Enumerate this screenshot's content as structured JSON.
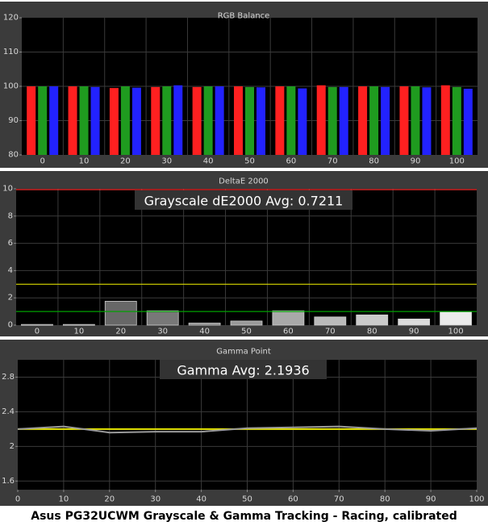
{
  "caption": "Asus PG32UCWM Grayscale & Gamma Tracking - Racing, calibrated",
  "colors": {
    "panel_bg": "#3b3b3b",
    "plot_bg": "#000000",
    "grid": "#3a3a3a",
    "text": "#d8d8d8",
    "red": "#ff2020",
    "green": "#1f9b1f",
    "blue": "#2222ff",
    "limit_red": "#ff3030",
    "limit_yellow": "#d8d800",
    "limit_green": "#00a000",
    "gamma_target": "#e6e600",
    "gamma_measured": "#9a9a9a"
  },
  "chart_data": [
    {
      "type": "bar",
      "title": "RGB Balance",
      "categories": [
        "0",
        "10",
        "20",
        "30",
        "40",
        "50",
        "60",
        "70",
        "80",
        "90",
        "100"
      ],
      "ylim": [
        80,
        120
      ],
      "yticks": [
        80,
        90,
        100,
        110,
        120
      ],
      "grid": true,
      "series": [
        {
          "color": "red",
          "values": [
            100,
            100,
            99.5,
            99.8,
            99.8,
            100,
            100,
            100.3,
            100,
            100,
            100.3
          ]
        },
        {
          "color": "green",
          "values": [
            100,
            100,
            100,
            100,
            100,
            99.8,
            100,
            99.8,
            100,
            100,
            99.8
          ]
        },
        {
          "color": "blue",
          "values": [
            100,
            99.8,
            99.6,
            100.3,
            100,
            99.7,
            99.4,
            99.8,
            99.8,
            99.7,
            99.3
          ]
        }
      ]
    },
    {
      "type": "bar",
      "title": "DeltaE 2000",
      "annotation": "Grayscale dE2000 Avg: 0.7211",
      "categories": [
        "0",
        "10",
        "20",
        "30",
        "40",
        "50",
        "60",
        "70",
        "80",
        "90",
        "100"
      ],
      "values": [
        0.05,
        0.05,
        1.75,
        1.05,
        0.15,
        0.3,
        1.05,
        0.6,
        0.75,
        0.45,
        1.0
      ],
      "ylim": [
        0,
        10
      ],
      "yticks": [
        0,
        2,
        4,
        6,
        8,
        10
      ],
      "limit_lines": [
        10,
        3,
        1
      ],
      "grid": true
    },
    {
      "type": "line",
      "title": "Gamma Point",
      "annotation": "Gamma Avg: 2.1936",
      "x": [
        0,
        10,
        20,
        30,
        40,
        50,
        60,
        70,
        80,
        90,
        100
      ],
      "xticks": [
        0,
        10,
        20,
        30,
        40,
        50,
        60,
        70,
        80,
        90,
        100
      ],
      "target": 2.2,
      "values": [
        2.2,
        2.23,
        2.16,
        2.17,
        2.17,
        2.21,
        2.22,
        2.23,
        2.2,
        2.18,
        2.21
      ],
      "xlim": [
        0,
        100
      ],
      "ylim": [
        1.5,
        3.0
      ],
      "yticks": [
        1.6,
        2,
        2.4,
        2.8
      ],
      "grid": true
    }
  ]
}
